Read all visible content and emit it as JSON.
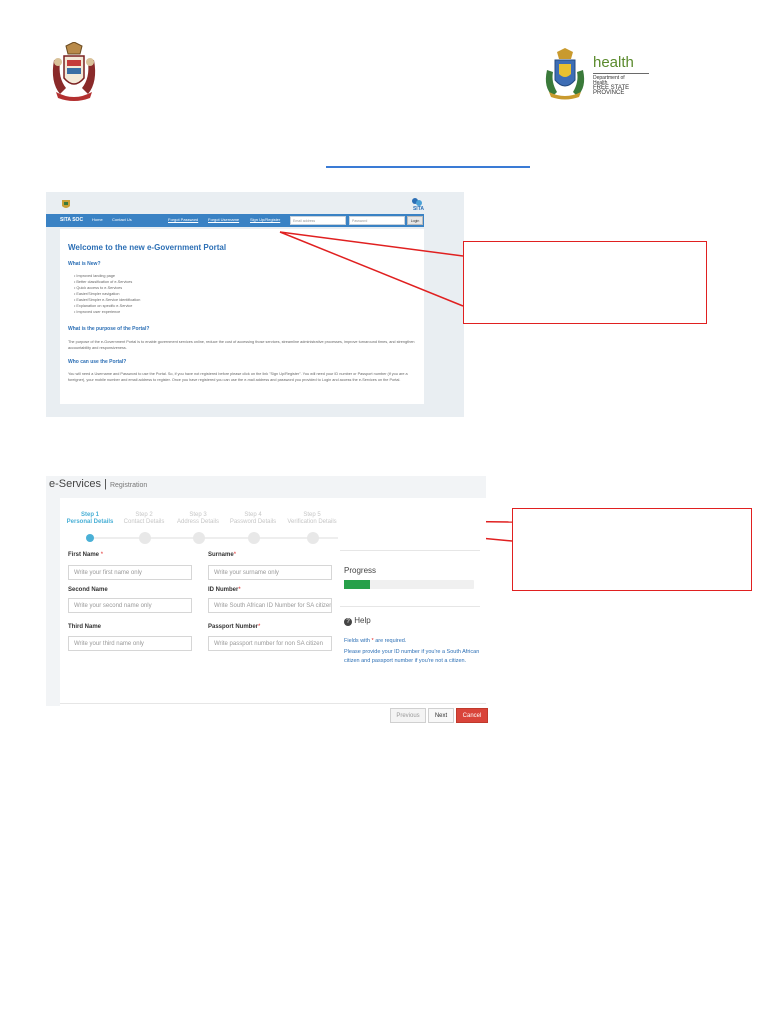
{
  "logos": {
    "crest_icon": "coat-of-arms-icon",
    "health": {
      "word": "health",
      "line1": "Department of",
      "line2": "Health",
      "line3": "FREE STATE PROVINCE"
    }
  },
  "portal": {
    "nav": {
      "brand": "SITA SOC",
      "items": [
        "Home",
        "Contact Us"
      ],
      "links": [
        "Forgot Password",
        "Forgot Username",
        "Sign Up/Register"
      ],
      "email_placeholder": "Email address",
      "password_placeholder": "Password",
      "login_label": "Login"
    },
    "logo_text": "SITA",
    "title": "Welcome to the new e-Government Portal",
    "whats_new_heading": "What is New?",
    "whats_new_items": [
      "Improved landing page",
      "Better classification of e-Services",
      "Quick access to e-Services",
      "Easier/Simpler navigation",
      "Easier/Simpler e-Service identification",
      "Explanation on specific e-Service",
      "Improved user experience"
    ],
    "purpose_heading": "What is the purpose of the Portal?",
    "purpose_text": "The purpose of the e-Government Portal is to enable government services online, reduce the cost of accessing those services, streamline administrative processes, improve turnaround times, and strengthen accountability and responsiveness.",
    "who_heading": "Who can use the Portal?",
    "who_text": "You will need a Username and Password to use the Portal. So, if you have not registered before please click on the link \"Sign Up/Register\". You will need your ID number or Passport number (if you are a foreigner), your mobile number and email address to register. Once you have registered you can use the e-mail address and password you provided to Login and access the e-Services on the Portal."
  },
  "eservices": {
    "title": "e-Services",
    "separator": "|",
    "subtitle": "Registration",
    "steps": [
      {
        "num": "Step 1",
        "name": "Personal Details"
      },
      {
        "num": "Step 2",
        "name": "Contact Details"
      },
      {
        "num": "Step 3",
        "name": "Address Details"
      },
      {
        "num": "Step 4",
        "name": "Password Details"
      },
      {
        "num": "Step 5",
        "name": "Verification Details"
      }
    ],
    "fields": {
      "first_name": {
        "label": "First Name",
        "placeholder": "Write your first name only"
      },
      "surname": {
        "label": "Surname",
        "placeholder": "Write your surname only"
      },
      "second_name": {
        "label": "Second Name",
        "placeholder": "Write your second name only"
      },
      "id_number": {
        "label": "ID Number",
        "placeholder": "Write South African ID Number for SA citizen"
      },
      "third_name": {
        "label": "Third Name",
        "placeholder": "Write your third name only"
      },
      "passport": {
        "label": "Passport Number",
        "placeholder": "Write passport number for non SA citizen"
      }
    },
    "required_mark": "*",
    "progress_label": "Progress",
    "progress_value": 0.2,
    "progress_color": "#27a04a",
    "help_title": "Help",
    "help_icon": "question-circle-icon",
    "help_required_a": "Fields with",
    "help_required_b": "are required.",
    "help_text": "Please provide your ID number if you're a South African citizen and passport number if you're not a citizen.",
    "buttons": {
      "previous": "Previous",
      "next": "Next",
      "cancel": "Cancel"
    }
  },
  "colors": {
    "accent": "#2c6fb5",
    "callout": "#e02020",
    "cancel": "#d9443a",
    "step_active": "#4ab0d6"
  }
}
